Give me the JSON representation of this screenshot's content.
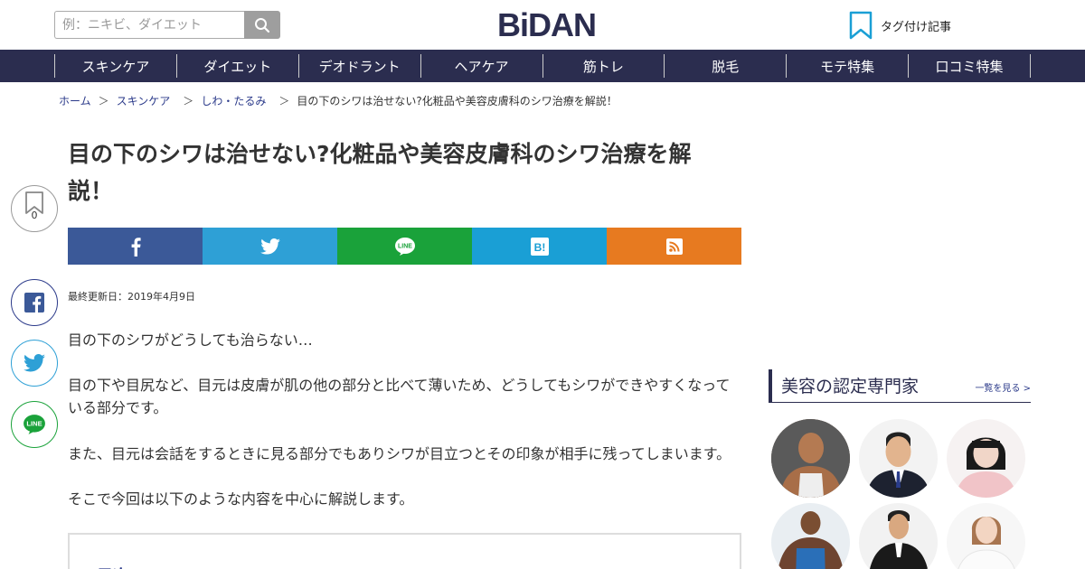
{
  "header": {
    "search_placeholder": "例：ニキビ、ダイエット",
    "logo": "BiDAN",
    "tagged_articles_label": "タグ付け記事"
  },
  "nav": {
    "items": [
      "スキンケア",
      "ダイエット",
      "デオドラント",
      "ヘアケア",
      "筋トレ",
      "脱毛",
      "モテ特集",
      "口コミ特集"
    ]
  },
  "breadcrumb": {
    "items": [
      "ホーム",
      "スキンケア",
      "しわ・たるみ"
    ],
    "separator": "＞",
    "current": "目の下のシワは治せない?化粧品や美容皮膚科のシワ治療を解説！"
  },
  "article": {
    "title": "目の下のシワは治せない?化粧品や美容皮膚科のシワ治療を解説！",
    "updated": "最終更新日：2019年4月9日",
    "paragraphs": [
      "目の下のシワがどうしても治らない…",
      "目の下や目尻など、目元は皮膚が肌の他の部分と比べて薄いため、どうしてもシワができやすくなっている部分です。",
      "また、目元は会話をするときに見る部分でもありシワが目立つとその印象が相手に残ってしまいます。",
      "そこで今回は以下のような内容を中心に解説します。"
    ],
    "toc_heading": "目次"
  },
  "share": {
    "colors": {
      "facebook": "#3b5998",
      "twitter": "#2ea0d6",
      "line": "#1aa23a",
      "hatena": "#1a9fd5",
      "rss": "#e77a20"
    }
  },
  "floating": {
    "bookmark_count": "0"
  },
  "sidebar": {
    "experts_title": "美容の認定専門家",
    "experts_more": "一覧を見る >"
  },
  "colors": {
    "brand_navy": "#2b2d4f",
    "link_blue": "#2b3a8a"
  }
}
